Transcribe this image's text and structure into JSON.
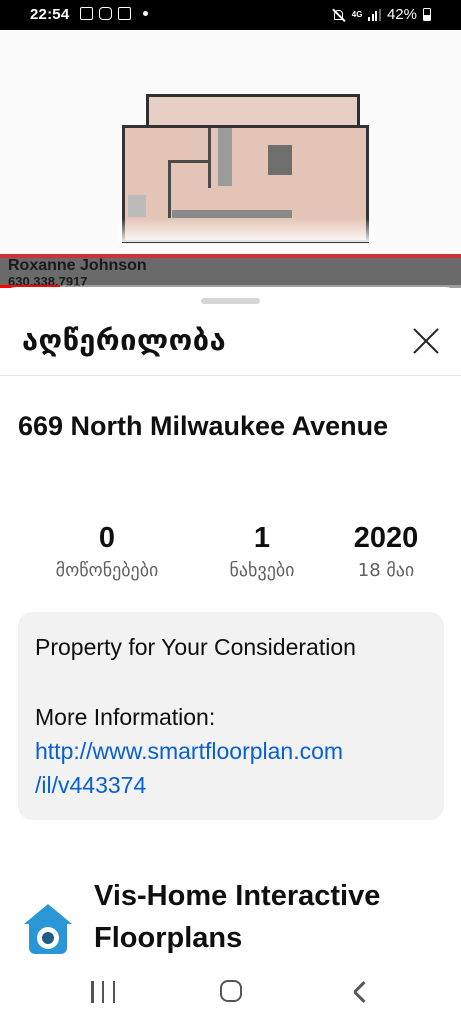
{
  "status_bar": {
    "time": "22:54",
    "battery": "42%",
    "network": "4G",
    "left_icons": [
      "gallery-icon",
      "instagram-icon",
      "gmail-icon",
      "notification-dot-icon"
    ],
    "right_icons": [
      "mute-icon",
      "network-icon",
      "signal-icon",
      "battery-icon"
    ]
  },
  "video": {
    "overlay_name": "Roxanne Johnson",
    "overlay_phone": "630.338.7917",
    "progress_fraction": 0.13,
    "colors": {
      "progress": "#ff0000",
      "ticker_accent": "#c93434"
    }
  },
  "description_sheet": {
    "header_title": "აღწერილობა",
    "video_title": "669 North Milwaukee Avenue",
    "stats": [
      {
        "value": "0",
        "label": "მოწონებები"
      },
      {
        "value": "1",
        "label": "ნახვები"
      },
      {
        "value": "2020",
        "label": "18 მაი"
      }
    ],
    "description": {
      "line1": "Property for Your Consideration",
      "line2": "More Information:",
      "link_line1": "http://www.smartfloorplan.com",
      "link_line2": "/il/v443374"
    },
    "channel": {
      "name": "Vis-Home Interactive Floorplans",
      "avatar_icon": "house-camera-icon"
    },
    "colors": {
      "link": "#065fd4",
      "desc_bg": "#f2f2f2",
      "avatar": "#2b96d6"
    }
  },
  "nav_bar": {
    "icons": [
      "recents-icon",
      "home-icon",
      "back-icon"
    ]
  }
}
